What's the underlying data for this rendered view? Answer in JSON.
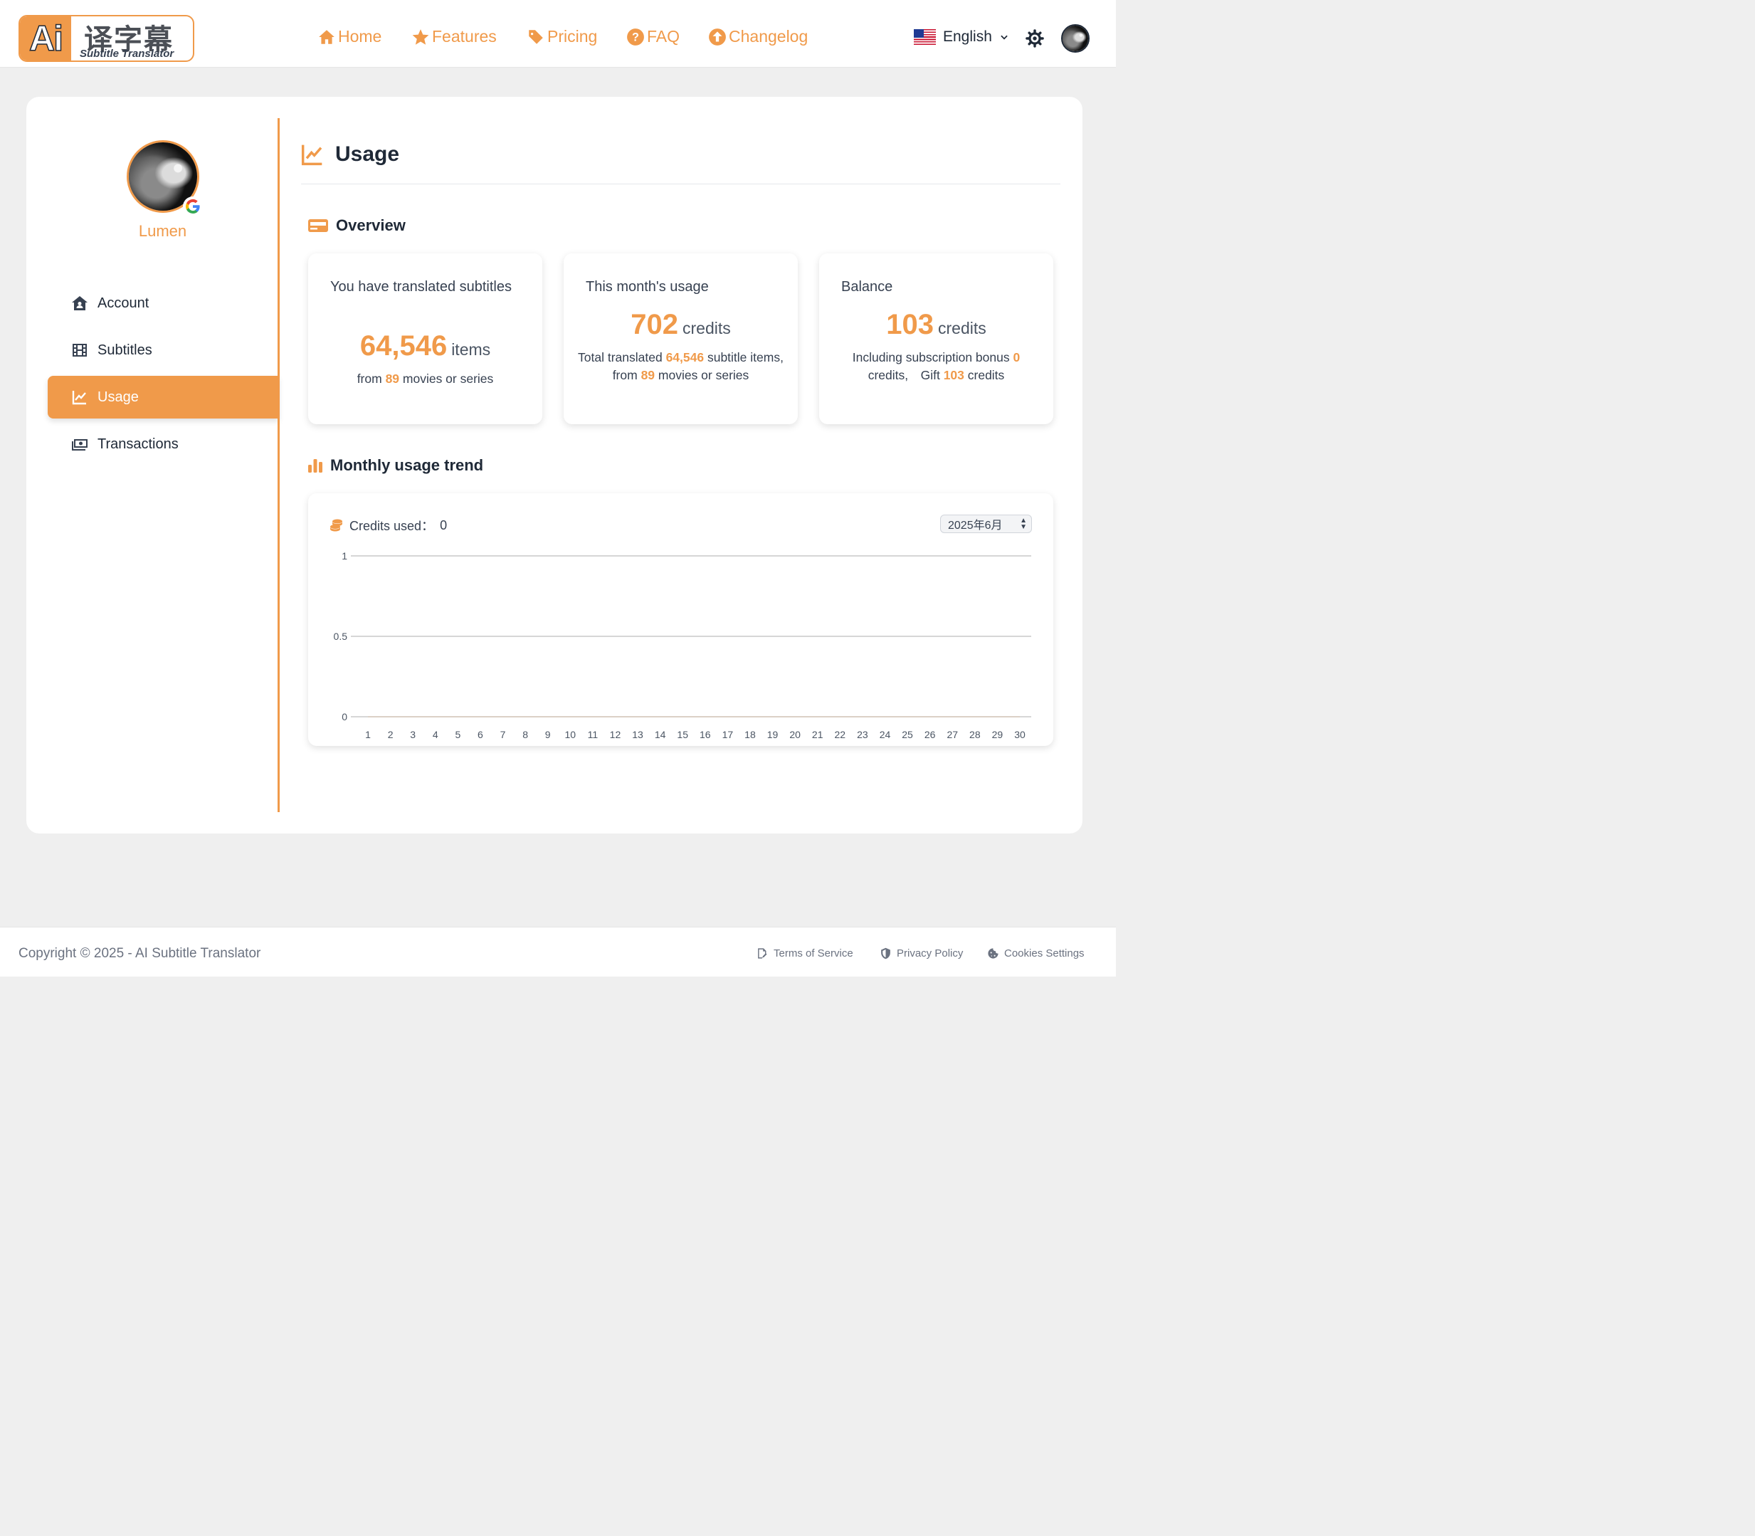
{
  "header": {
    "logo_ai": "Ai",
    "logo_cn": "译字幕",
    "logo_en": "Subtitle Translator",
    "nav": [
      {
        "label": "Home",
        "icon": "home-icon"
      },
      {
        "label": "Features",
        "icon": "star-icon"
      },
      {
        "label": "Pricing",
        "icon": "tag-icon"
      },
      {
        "label": "FAQ",
        "icon": "question-circle-icon"
      },
      {
        "label": "Changelog",
        "icon": "arrow-up-circle-icon"
      }
    ],
    "language": "English"
  },
  "sidebar": {
    "user_name": "Lumen",
    "items": [
      {
        "label": "Account",
        "icon": "user-house-icon"
      },
      {
        "label": "Subtitles",
        "icon": "film-icon"
      },
      {
        "label": "Usage",
        "icon": "chart-line-icon"
      },
      {
        "label": "Transactions",
        "icon": "money-bill-icon"
      }
    ]
  },
  "main": {
    "title": "Usage",
    "overview_title": "Overview",
    "stats": [
      {
        "title": "You have translated subtitles",
        "value": "64,546",
        "unit": "items",
        "desc_prefix": "from ",
        "desc_num": "89",
        "desc_suffix": " movies or series"
      },
      {
        "title": "This month's usage",
        "value": "702",
        "unit": "credits",
        "desc_a": "Total translated ",
        "desc_num1": "64,546",
        "desc_b": " subtitle items,　from ",
        "desc_num2": "89",
        "desc_c": " movies or series"
      },
      {
        "title": "Balance",
        "value": "103",
        "unit": "credits",
        "desc_a": "Including subscription bonus ",
        "desc_num1": "0",
        "desc_b": " credits,　Gift ",
        "desc_num2": "103",
        "desc_c": " credits"
      }
    ],
    "trend_title": "Monthly usage trend",
    "credits_used_label": "Credits used：",
    "credits_used_value": "0",
    "month_select": "2025年6月"
  },
  "chart_data": {
    "type": "line",
    "x": [
      1,
      2,
      3,
      4,
      5,
      6,
      7,
      8,
      9,
      10,
      11,
      12,
      13,
      14,
      15,
      16,
      17,
      18,
      19,
      20,
      21,
      22,
      23,
      24,
      25,
      26,
      27,
      28,
      29,
      30
    ],
    "values": [
      0,
      0,
      0,
      0,
      0,
      0,
      0,
      0,
      0,
      0,
      0,
      0,
      0,
      0,
      0,
      0,
      0,
      0,
      0,
      0,
      0,
      0,
      0,
      0,
      0,
      0,
      0,
      0,
      0,
      0
    ],
    "yticks": [
      "1",
      "0.5",
      "0"
    ],
    "ylim": [
      0,
      1
    ],
    "grid": true,
    "accent": "#f09a4a"
  },
  "footer": {
    "copyright": "Copyright © 2025 - AI Subtitle Translator",
    "links": [
      "Terms of Service",
      "Privacy Policy",
      "Cookies Settings"
    ]
  },
  "colors": {
    "accent": "#f09a4a",
    "background": "#efefef",
    "text": "#1f2937"
  }
}
